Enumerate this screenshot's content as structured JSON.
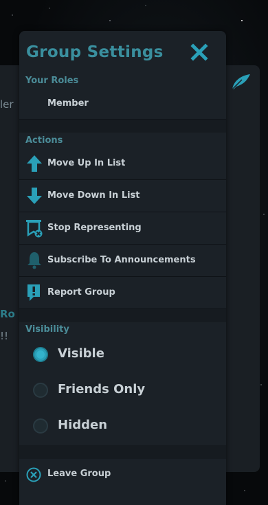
{
  "background": {
    "text_fragment_1": "ler",
    "text_fragment_2": "Ro",
    "text_fragment_3": "!!"
  },
  "panel": {
    "title": "Group Settings",
    "close_icon": "close-icon"
  },
  "roles": {
    "label": "Your Roles",
    "items": [
      {
        "label": "Member"
      }
    ]
  },
  "actions": {
    "label": "Actions",
    "items": [
      {
        "label": "Move Up In List",
        "icon": "arrow-up-icon"
      },
      {
        "label": "Move Down In List",
        "icon": "arrow-down-icon"
      },
      {
        "label": "Stop Representing",
        "icon": "banner-remove-icon"
      },
      {
        "label": "Subscribe To Announcements",
        "icon": "bell-icon"
      },
      {
        "label": "Report Group",
        "icon": "report-icon"
      }
    ]
  },
  "visibility": {
    "label": "Visibility",
    "options": [
      {
        "label": "Visible",
        "selected": true
      },
      {
        "label": "Friends Only",
        "selected": false
      },
      {
        "label": "Hidden",
        "selected": false
      }
    ]
  },
  "leave": {
    "label": "Leave Group",
    "icon": "leave-circle-icon"
  },
  "colors": {
    "accent": "#2aa0b8",
    "title": "#3a8f9e",
    "section": "#4b8c98",
    "panel_bg": "#1b2127",
    "text": "#c8d0d5"
  }
}
